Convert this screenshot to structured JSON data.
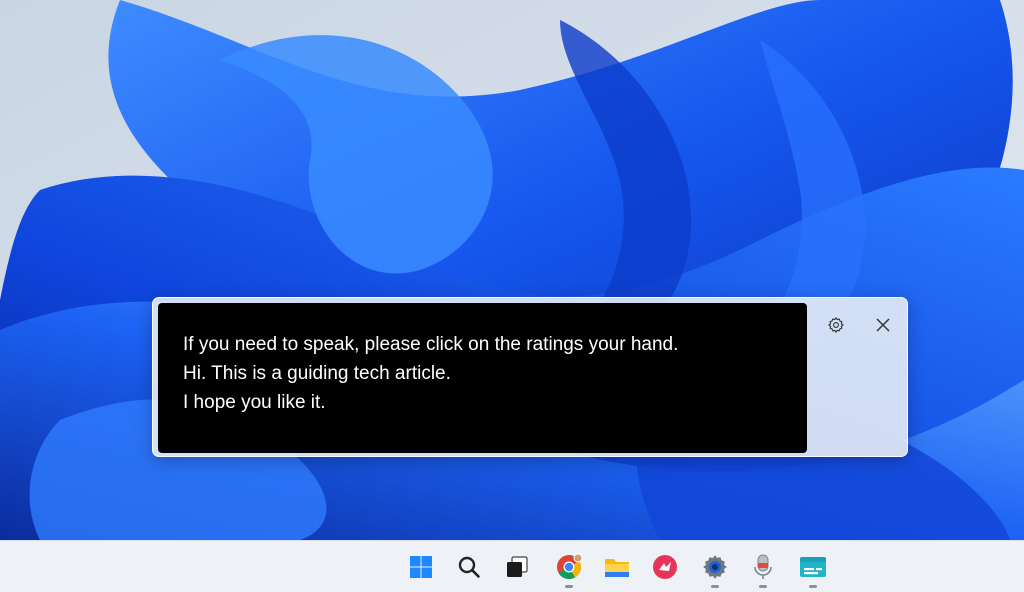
{
  "captions": {
    "lines": [
      "If you need to speak, please click on the ratings your hand.",
      "Hi. This is a guiding tech article.",
      "I hope you like it."
    ],
    "buttons": {
      "settings": "gear-icon",
      "close": "close-icon"
    }
  },
  "taskbar": {
    "items": [
      {
        "name": "start",
        "icon": "windows-logo-icon",
        "running": false
      },
      {
        "name": "search",
        "icon": "search-icon",
        "running": false
      },
      {
        "name": "task-view",
        "icon": "task-view-icon",
        "running": false
      },
      {
        "name": "chrome",
        "icon": "chrome-icon",
        "running": true
      },
      {
        "name": "file-explorer",
        "icon": "folder-icon",
        "running": false
      },
      {
        "name": "app-red",
        "icon": "red-app-icon",
        "running": false
      },
      {
        "name": "settings",
        "icon": "settings-gear-icon",
        "running": true
      },
      {
        "name": "voice-recorder",
        "icon": "microphone-icon",
        "running": true
      },
      {
        "name": "live-captions",
        "icon": "captions-icon",
        "running": true
      }
    ]
  },
  "colors": {
    "wallpaper_blue": "#1a5cf0",
    "wallpaper_bg": "#d6dfea",
    "caption_bg": "#000000",
    "caption_text": "#ffffff",
    "taskbar_bg": "#eef1f6"
  }
}
